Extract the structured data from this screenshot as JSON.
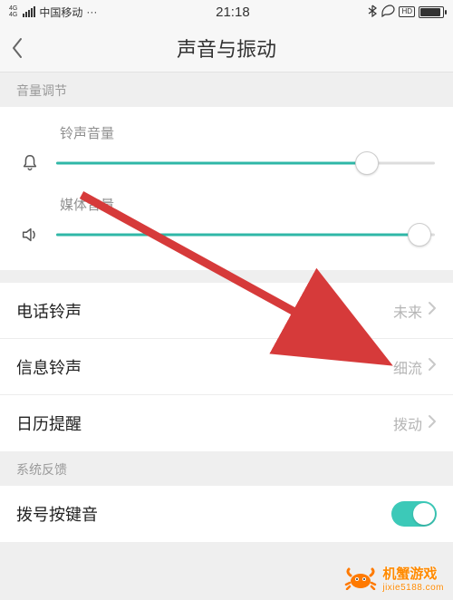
{
  "status": {
    "carrier": "中国移动",
    "net_badge_top": "4G",
    "net_badge_bottom": "4G",
    "dots": "···",
    "time": "21:18",
    "hd": "HD"
  },
  "nav": {
    "title": "声音与振动"
  },
  "sections": {
    "volume_header": "音量调节",
    "feedback_header": "系统反馈"
  },
  "sliders": {
    "ringtone": {
      "label": "铃声音量",
      "percent": 82
    },
    "media": {
      "label": "媒体音量",
      "percent": 96
    }
  },
  "rows": {
    "phone_ringtone": {
      "label": "电话铃声",
      "value": "未来"
    },
    "sms_ringtone": {
      "label": "信息铃声",
      "value": "细流"
    },
    "calendar_alert": {
      "label": "日历提醒",
      "value": "拨动"
    },
    "dial_keytone": {
      "label": "拨号按键音",
      "on": true
    }
  },
  "watermark": {
    "brand": "机蟹游戏",
    "url": "jixie5188.com"
  }
}
